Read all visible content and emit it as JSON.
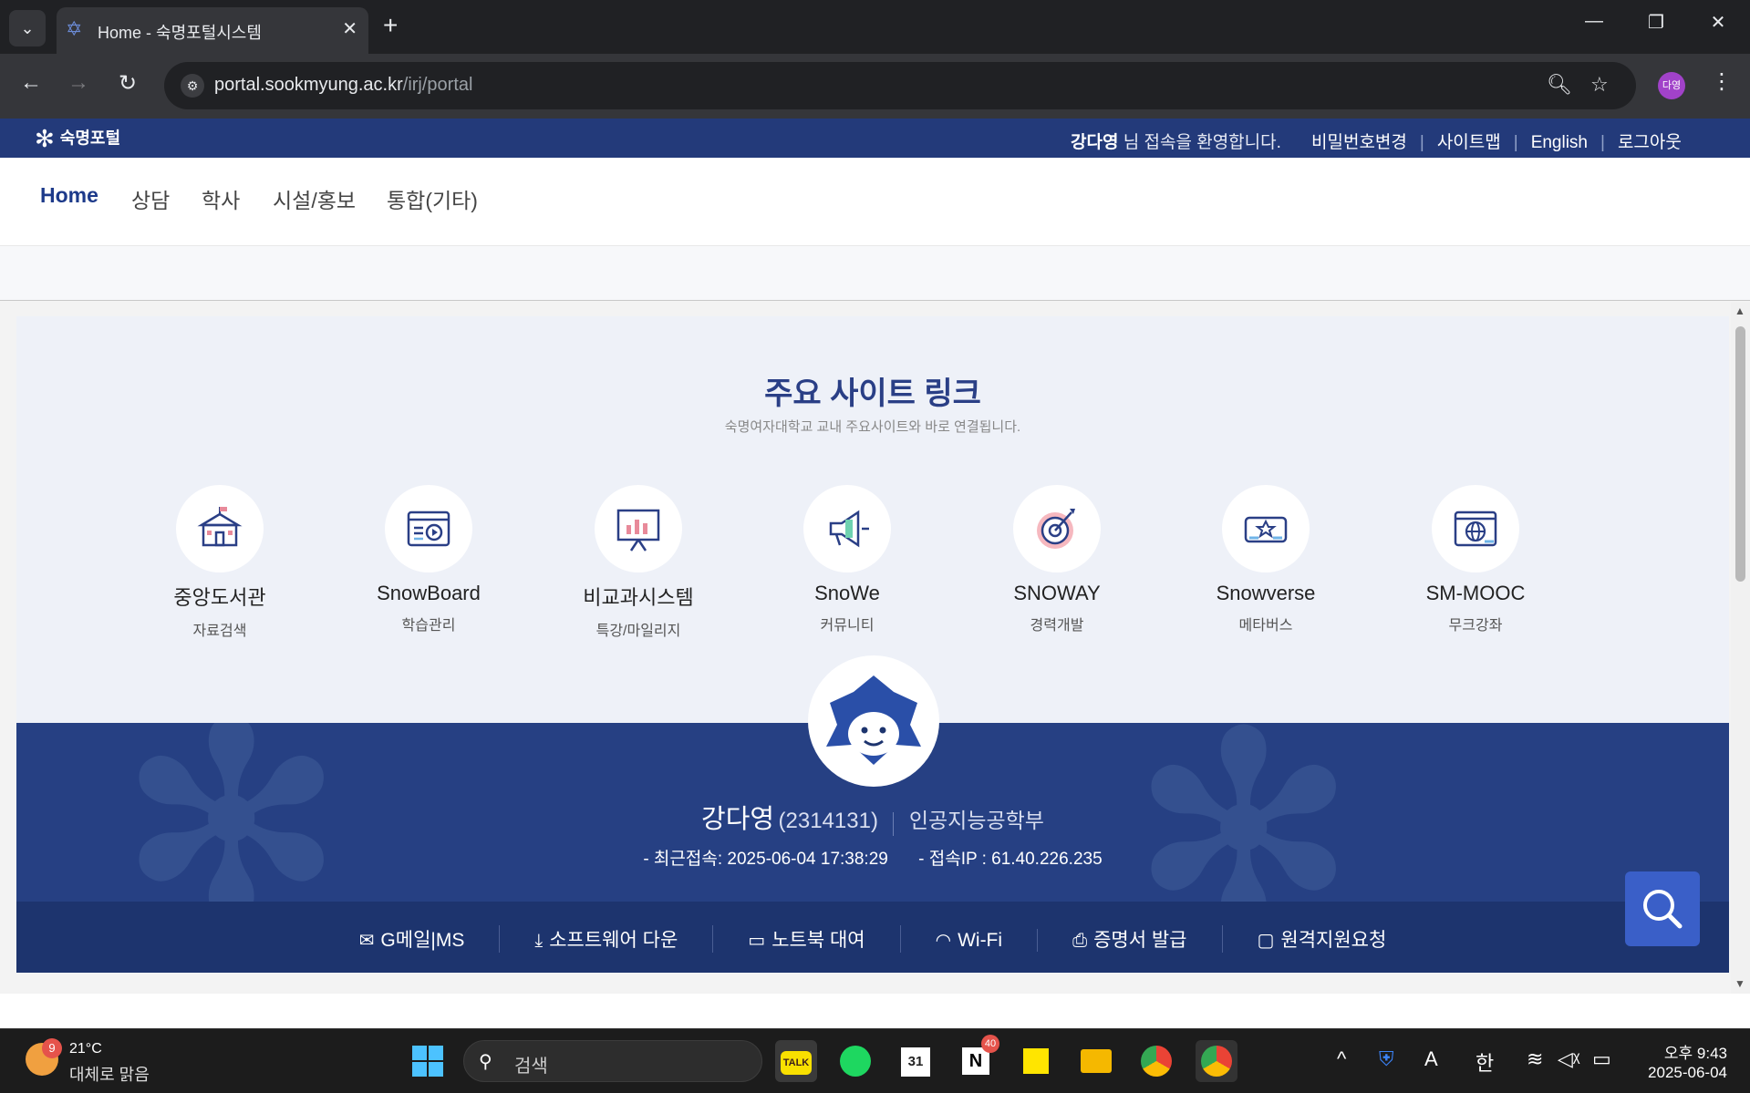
{
  "browser": {
    "tab_title": "Home - 숙명포털시스템",
    "url_host": "portal.sookmyung.ac.kr",
    "url_path": "/irj/portal",
    "profile_label": "다영"
  },
  "portal": {
    "logo_text": "숙명포털",
    "welcome_name": "강다영",
    "welcome_text": " 님 접속을 환영합니다.",
    "top_links": [
      "비밀번호변경",
      "사이트맵",
      "English",
      "로그아웃"
    ],
    "nav": [
      "Home",
      "상담",
      "학사",
      "시설/홍보",
      "통합(기타)"
    ]
  },
  "links_section": {
    "title": "주요 사이트 링크",
    "subtitle": "숙명여자대학교 교내 주요사이트와 바로 연결됩니다.",
    "sites": [
      {
        "name": "중앙도서관",
        "desc": "자료검색",
        "icon": "library-icon"
      },
      {
        "name": "SnowBoard",
        "desc": "학습관리",
        "icon": "video-board-icon"
      },
      {
        "name": "비교과시스템",
        "desc": "특강/마일리지",
        "icon": "presentation-board-icon"
      },
      {
        "name": "SnoWe",
        "desc": "커뮤니티",
        "icon": "megaphone-icon"
      },
      {
        "name": "SNOWAY",
        "desc": "경력개발",
        "icon": "target-icon"
      },
      {
        "name": "Snowverse",
        "desc": "메타버스",
        "icon": "vr-headset-icon"
      },
      {
        "name": "SM-MOOC",
        "desc": "무크강좌",
        "icon": "globe-window-icon"
      }
    ]
  },
  "user": {
    "name": "강다영",
    "student_id": "(2314131)",
    "department": "인공지능공학부",
    "last_access": "- 최근접속: 2025-06-04 17:38:29",
    "access_ip": "- 접속IP : 61.40.226.235"
  },
  "quick_links": [
    {
      "label": "G메일|MS",
      "icon": "mail-icon",
      "glyph": "✉"
    },
    {
      "label": "소프트웨어 다운",
      "icon": "download-icon",
      "glyph": "⤓"
    },
    {
      "label": "노트북 대여",
      "icon": "laptop-icon",
      "glyph": "▭"
    },
    {
      "label": "Wi-Fi",
      "icon": "wifi-icon",
      "glyph": "◠"
    },
    {
      "label": "증명서 발급",
      "icon": "printer-icon",
      "glyph": "⎙"
    },
    {
      "label": "원격지원요청",
      "icon": "monitor-icon",
      "glyph": "▢"
    }
  ],
  "taskbar": {
    "weather_badge": "9",
    "temperature": "21°C",
    "weather_desc": "대체로 맑음",
    "search_placeholder": "검색",
    "notion_badge": "40",
    "ime_mode": "한",
    "time": "오후 9:43",
    "date": "2025-06-04"
  },
  "colors": {
    "portal_navy": "#233a7a",
    "profile_band": "#264083",
    "quick_bar": "#1d346e",
    "accent_blue": "#3a5fc8"
  }
}
